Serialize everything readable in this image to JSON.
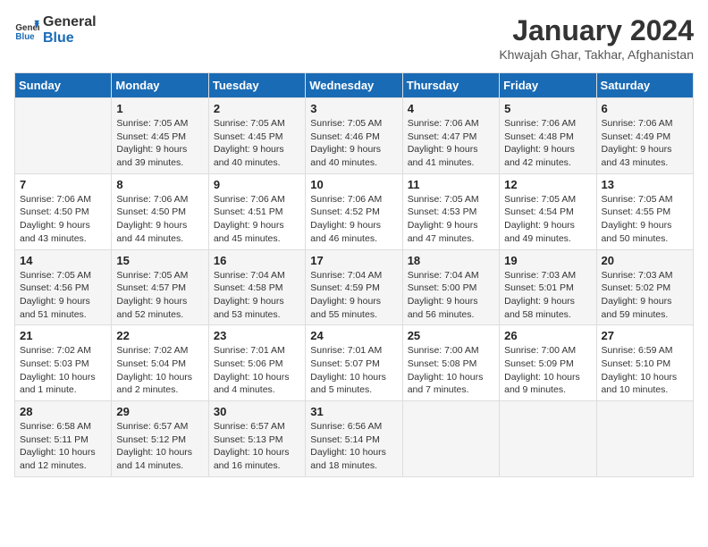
{
  "logo": {
    "line1": "General",
    "line2": "Blue"
  },
  "title": "January 2024",
  "subtitle": "Khwajah Ghar, Takhar, Afghanistan",
  "days_of_week": [
    "Sunday",
    "Monday",
    "Tuesday",
    "Wednesday",
    "Thursday",
    "Friday",
    "Saturday"
  ],
  "weeks": [
    [
      {
        "day": "",
        "info": ""
      },
      {
        "day": "1",
        "info": "Sunrise: 7:05 AM\nSunset: 4:45 PM\nDaylight: 9 hours\nand 39 minutes."
      },
      {
        "day": "2",
        "info": "Sunrise: 7:05 AM\nSunset: 4:45 PM\nDaylight: 9 hours\nand 40 minutes."
      },
      {
        "day": "3",
        "info": "Sunrise: 7:05 AM\nSunset: 4:46 PM\nDaylight: 9 hours\nand 40 minutes."
      },
      {
        "day": "4",
        "info": "Sunrise: 7:06 AM\nSunset: 4:47 PM\nDaylight: 9 hours\nand 41 minutes."
      },
      {
        "day": "5",
        "info": "Sunrise: 7:06 AM\nSunset: 4:48 PM\nDaylight: 9 hours\nand 42 minutes."
      },
      {
        "day": "6",
        "info": "Sunrise: 7:06 AM\nSunset: 4:49 PM\nDaylight: 9 hours\nand 43 minutes."
      }
    ],
    [
      {
        "day": "7",
        "info": "Sunrise: 7:06 AM\nSunset: 4:50 PM\nDaylight: 9 hours\nand 43 minutes."
      },
      {
        "day": "8",
        "info": "Sunrise: 7:06 AM\nSunset: 4:50 PM\nDaylight: 9 hours\nand 44 minutes."
      },
      {
        "day": "9",
        "info": "Sunrise: 7:06 AM\nSunset: 4:51 PM\nDaylight: 9 hours\nand 45 minutes."
      },
      {
        "day": "10",
        "info": "Sunrise: 7:06 AM\nSunset: 4:52 PM\nDaylight: 9 hours\nand 46 minutes."
      },
      {
        "day": "11",
        "info": "Sunrise: 7:05 AM\nSunset: 4:53 PM\nDaylight: 9 hours\nand 47 minutes."
      },
      {
        "day": "12",
        "info": "Sunrise: 7:05 AM\nSunset: 4:54 PM\nDaylight: 9 hours\nand 49 minutes."
      },
      {
        "day": "13",
        "info": "Sunrise: 7:05 AM\nSunset: 4:55 PM\nDaylight: 9 hours\nand 50 minutes."
      }
    ],
    [
      {
        "day": "14",
        "info": "Sunrise: 7:05 AM\nSunset: 4:56 PM\nDaylight: 9 hours\nand 51 minutes."
      },
      {
        "day": "15",
        "info": "Sunrise: 7:05 AM\nSunset: 4:57 PM\nDaylight: 9 hours\nand 52 minutes."
      },
      {
        "day": "16",
        "info": "Sunrise: 7:04 AM\nSunset: 4:58 PM\nDaylight: 9 hours\nand 53 minutes."
      },
      {
        "day": "17",
        "info": "Sunrise: 7:04 AM\nSunset: 4:59 PM\nDaylight: 9 hours\nand 55 minutes."
      },
      {
        "day": "18",
        "info": "Sunrise: 7:04 AM\nSunset: 5:00 PM\nDaylight: 9 hours\nand 56 minutes."
      },
      {
        "day": "19",
        "info": "Sunrise: 7:03 AM\nSunset: 5:01 PM\nDaylight: 9 hours\nand 58 minutes."
      },
      {
        "day": "20",
        "info": "Sunrise: 7:03 AM\nSunset: 5:02 PM\nDaylight: 9 hours\nand 59 minutes."
      }
    ],
    [
      {
        "day": "21",
        "info": "Sunrise: 7:02 AM\nSunset: 5:03 PM\nDaylight: 10 hours\nand 1 minute."
      },
      {
        "day": "22",
        "info": "Sunrise: 7:02 AM\nSunset: 5:04 PM\nDaylight: 10 hours\nand 2 minutes."
      },
      {
        "day": "23",
        "info": "Sunrise: 7:01 AM\nSunset: 5:06 PM\nDaylight: 10 hours\nand 4 minutes."
      },
      {
        "day": "24",
        "info": "Sunrise: 7:01 AM\nSunset: 5:07 PM\nDaylight: 10 hours\nand 5 minutes."
      },
      {
        "day": "25",
        "info": "Sunrise: 7:00 AM\nSunset: 5:08 PM\nDaylight: 10 hours\nand 7 minutes."
      },
      {
        "day": "26",
        "info": "Sunrise: 7:00 AM\nSunset: 5:09 PM\nDaylight: 10 hours\nand 9 minutes."
      },
      {
        "day": "27",
        "info": "Sunrise: 6:59 AM\nSunset: 5:10 PM\nDaylight: 10 hours\nand 10 minutes."
      }
    ],
    [
      {
        "day": "28",
        "info": "Sunrise: 6:58 AM\nSunset: 5:11 PM\nDaylight: 10 hours\nand 12 minutes."
      },
      {
        "day": "29",
        "info": "Sunrise: 6:57 AM\nSunset: 5:12 PM\nDaylight: 10 hours\nand 14 minutes."
      },
      {
        "day": "30",
        "info": "Sunrise: 6:57 AM\nSunset: 5:13 PM\nDaylight: 10 hours\nand 16 minutes."
      },
      {
        "day": "31",
        "info": "Sunrise: 6:56 AM\nSunset: 5:14 PM\nDaylight: 10 hours\nand 18 minutes."
      },
      {
        "day": "",
        "info": ""
      },
      {
        "day": "",
        "info": ""
      },
      {
        "day": "",
        "info": ""
      }
    ]
  ]
}
